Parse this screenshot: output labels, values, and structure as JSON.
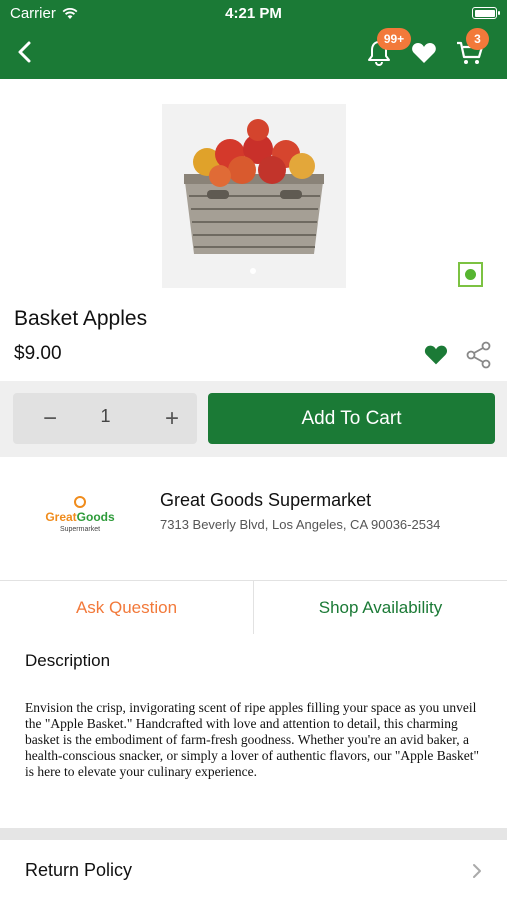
{
  "status_bar": {
    "carrier": "Carrier",
    "time": "4:21 PM"
  },
  "header": {
    "notification_badge": "99+",
    "cart_badge": "3"
  },
  "product": {
    "name": "Basket Apples",
    "price": "$9.00",
    "image_icon": "apple-basket-image"
  },
  "cart": {
    "quantity": "1",
    "minus": "−",
    "plus": "+",
    "add_to_cart": "Add To Cart"
  },
  "store": {
    "logo_word_1": "Great",
    "logo_word_2": "Goods",
    "logo_sub": "Supermarket",
    "name": "Great Goods Supermarket",
    "address": "7313 Beverly Blvd, Los Angeles, CA 90036-2534"
  },
  "tabs": [
    {
      "label": "Ask Question",
      "color": "#f2793a"
    },
    {
      "label": "Shop Availability",
      "color": "#1b7a36"
    }
  ],
  "description": {
    "title": "Description",
    "text": "Envision the crisp, invigorating scent of ripe apples filling your space as you unveil the \"Apple Basket.\" Handcrafted with love and attention to detail, this charming basket is the embodiment of farm-fresh goodness. Whether you're an avid baker, a health-conscious snacker, or simply a lover of authentic flavors, our \"Apple Basket\" is here to elevate your culinary experience."
  },
  "return_policy": {
    "label": "Return Policy"
  },
  "colors": {
    "brand_green": "#1b7a36",
    "accent_orange": "#f2793a",
    "variant_green": "#56b530"
  }
}
